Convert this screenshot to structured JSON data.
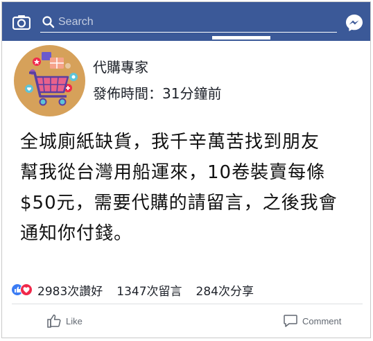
{
  "topbar": {
    "search_placeholder": "Search",
    "bar_color": "#3b5998"
  },
  "post": {
    "page_name": "代購專家",
    "time_label": "發佈時間：31分鐘前",
    "body_lines": [
      "全城廁紙缺貨，我千辛萬苦找到朋友",
      "幫我從台灣用船運來，10卷裝賣每條",
      "$50元，需要代購的請留言，之後我會",
      "通知你付錢。"
    ],
    "avatar_icon": "shopping-cart-icon",
    "avatar_color": "#d6a15a"
  },
  "stats": {
    "likes": "2983次讚好",
    "comments": "1347次留言",
    "shares": "284次分享"
  },
  "actions": {
    "like_label": "Like",
    "comment_label": "Comment"
  }
}
